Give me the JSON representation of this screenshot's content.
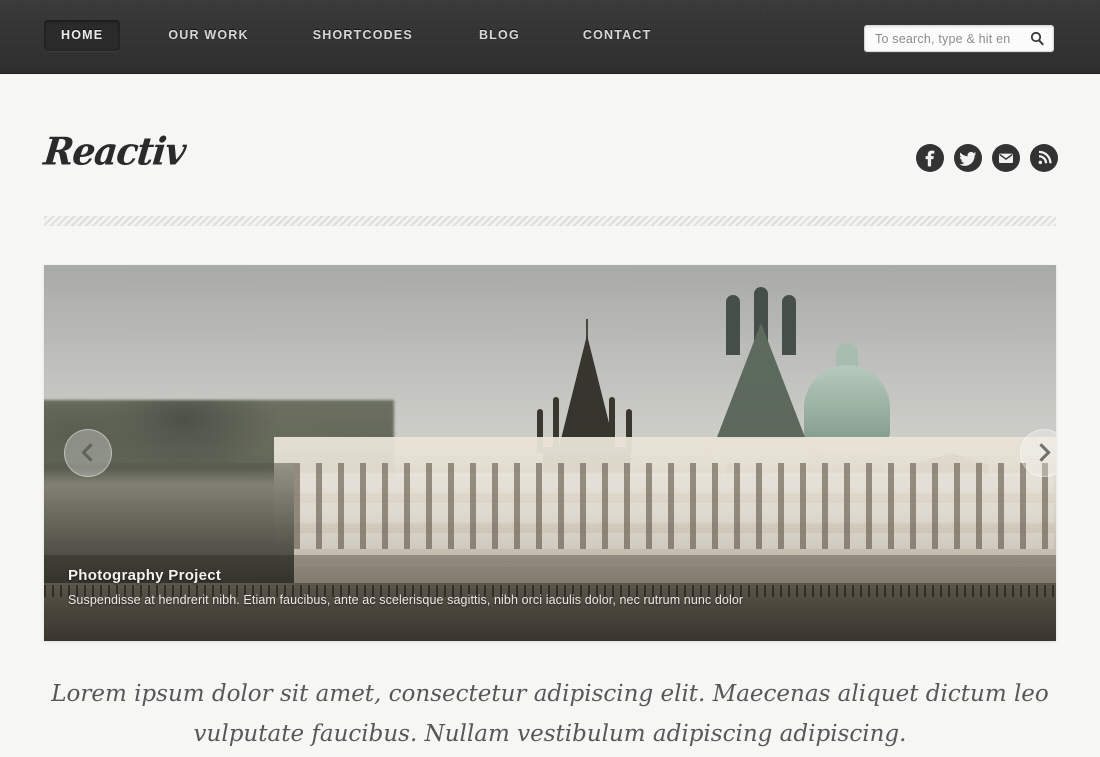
{
  "site": {
    "logo_text": "Reactiv"
  },
  "nav": {
    "items": [
      {
        "label": "HOME",
        "active": true
      },
      {
        "label": "OUR WORK",
        "active": false
      },
      {
        "label": "SHORTCODES",
        "active": false
      },
      {
        "label": "BLOG",
        "active": false
      },
      {
        "label": "CONTACT",
        "active": false
      }
    ]
  },
  "search": {
    "placeholder": "To search, type & hit en",
    "value": "",
    "icon": "search-icon"
  },
  "socials": [
    {
      "name": "facebook-icon",
      "label": "Facebook",
      "color": "#333333"
    },
    {
      "name": "twitter-icon",
      "label": "Twitter",
      "color": "#333333"
    },
    {
      "name": "email-icon",
      "label": "Email",
      "color": "#333333"
    },
    {
      "name": "rss-icon",
      "label": "RSS",
      "color": "#333333"
    }
  ],
  "slider": {
    "caption_title": "Photography Project",
    "caption_desc": "Suspendisse at hendrerit nibh. Etiam faucibus, ante ac scelerisque sagittis, nibh orci iaculis dolor, nec rutrum nunc dolor",
    "prev_label": "Previous slide",
    "next_label": "Next slide"
  },
  "tagline": {
    "text": "Lorem ipsum dolor sit amet, consectetur adipiscing elit. Maecenas aliquet dictum leo vulputate faucibus. Nullam vestibulum adipiscing adipiscing."
  },
  "colors": {
    "topbar": "#343434",
    "page_bg": "#f7f7f6",
    "text_dark": "#2b2b2b",
    "tagline_grey": "#585858"
  }
}
